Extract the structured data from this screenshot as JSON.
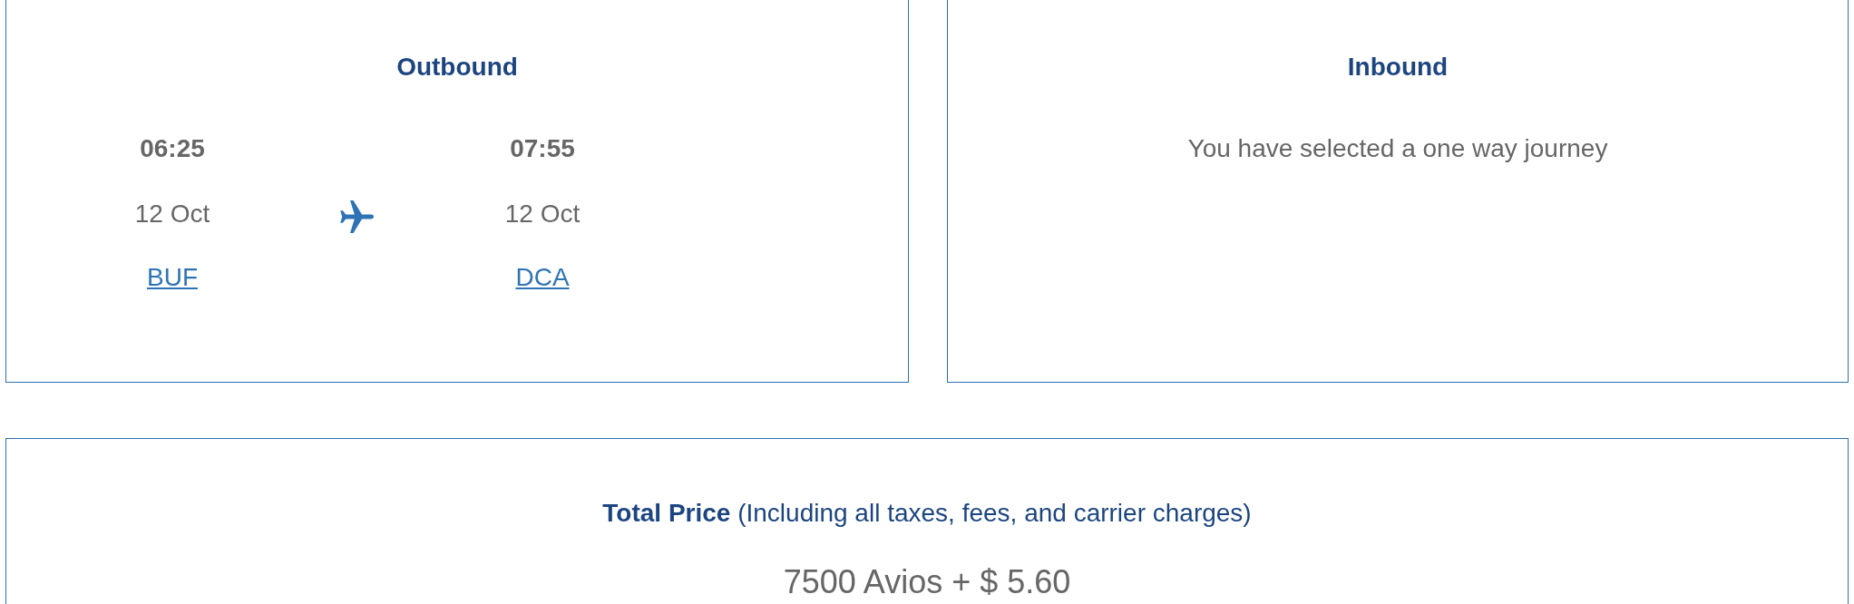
{
  "outbound": {
    "title": "Outbound",
    "departure": {
      "time": "06:25",
      "date": "12 Oct",
      "airport": "BUF"
    },
    "arrival": {
      "time": "07:55",
      "date": "12 Oct",
      "airport": "DCA"
    }
  },
  "inbound": {
    "title": "Inbound",
    "message": "You have selected a one way journey"
  },
  "total": {
    "label": "**Total Price** (Including all taxes, fees, and carrier charges)",
    "price": "7500 Avios + $ 5.60"
  }
}
